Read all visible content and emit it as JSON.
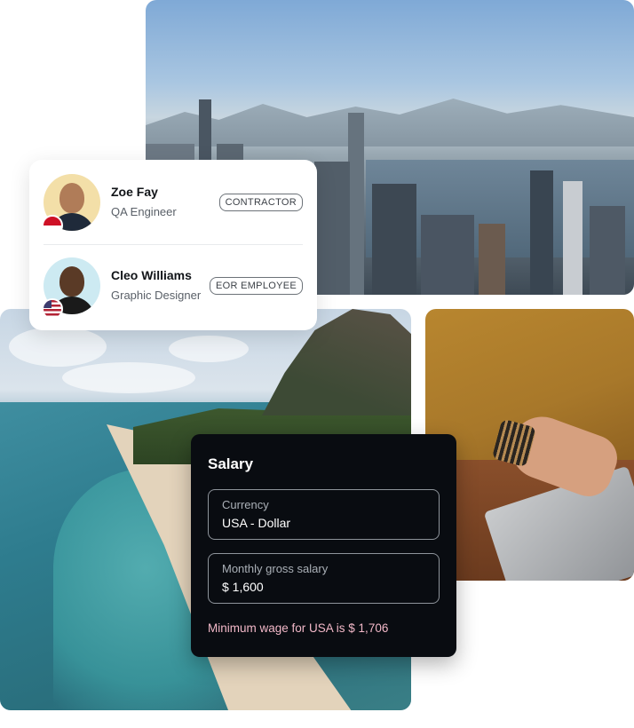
{
  "employees": [
    {
      "name": "Zoe Fay",
      "role": "QA Engineer",
      "type": "CONTRACTOR",
      "flag": "indonesia-flag-icon"
    },
    {
      "name": "Cleo Williams",
      "role": "Graphic Designer",
      "type": "EOR EMPLOYEE",
      "flag": "usa-flag-icon"
    }
  ],
  "salary": {
    "title": "Salary",
    "currency_label": "Currency",
    "currency_value": "USA - Dollar",
    "monthly_label": "Monthly gross salary",
    "monthly_value": "$ 1,600",
    "minimum_note": "Minimum wage for USA is $ 1,706"
  },
  "colors": {
    "card_dark": "#090c11",
    "note_pink": "#f2b8c8"
  }
}
